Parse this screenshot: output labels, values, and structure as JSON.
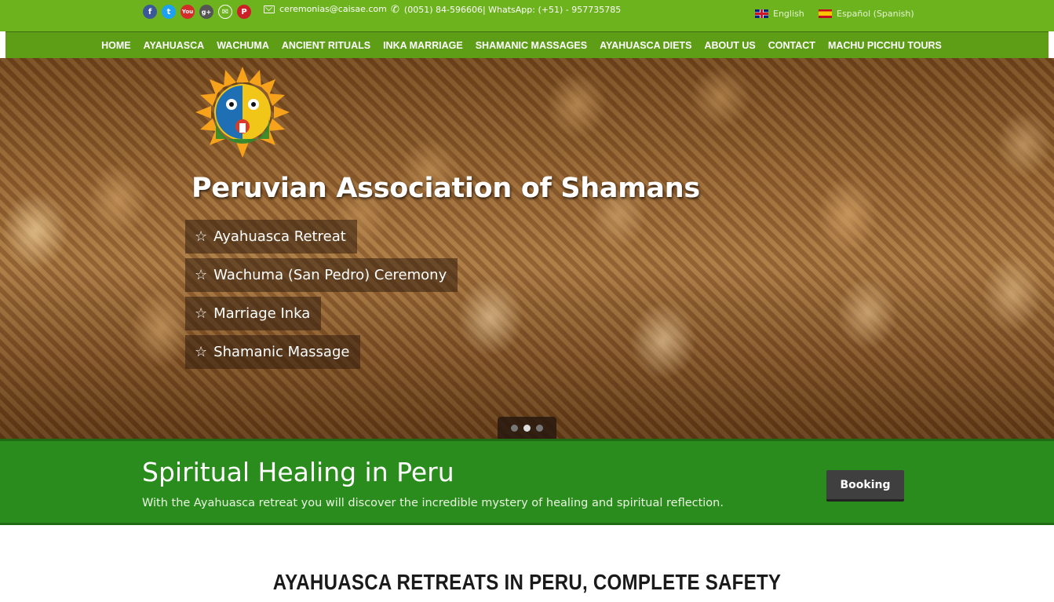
{
  "topbar": {
    "social": [
      {
        "icon": "facebook-icon",
        "glyph": "f"
      },
      {
        "icon": "twitter-icon",
        "glyph": "t"
      },
      {
        "icon": "youtube-icon",
        "glyph": "You"
      },
      {
        "icon": "google-plus-icon",
        "glyph": "g+"
      },
      {
        "icon": "mail-icon",
        "glyph": "✉"
      },
      {
        "icon": "pinterest-icon",
        "glyph": "P"
      }
    ],
    "email": "ceremonias@caisae.com",
    "phone": "(0051) 84-596606| WhatsApp: (+51) - 957735785",
    "languages": {
      "english": "English",
      "spanish": "Español (Spanish)"
    },
    "colors": {
      "bar": "#6cb31e",
      "nav": "#5d9e16"
    }
  },
  "nav": {
    "items": [
      "HOME",
      "AYAHUASCA",
      "WACHUMA",
      "ANCIENT RITUALS",
      "INKA MARRIAGE",
      "SHAMANIC MASSAGES",
      "AYAHUASCA DIETS",
      "ABOUT US",
      "CONTACT",
      "MACHU PICCHU TOURS"
    ]
  },
  "hero": {
    "title": "Peruvian Association of Shamans",
    "items": [
      "Ayahuasca Retreat",
      "Wachuma (San Pedro) Ceremony",
      "Marriage Inka",
      "Shamanic Massage"
    ],
    "slides": 3,
    "active_slide": 2
  },
  "band": {
    "title": "Spiritual Healing in Peru",
    "description": "With the Ayahuasca retreat you will discover the incredible mystery of healing and spiritual reflection.",
    "button": "Booking",
    "color": "#2a8c1c"
  },
  "content": {
    "section_title": "AYAHUASCA RETREATS IN PERU, COMPLETE SAFETY"
  }
}
